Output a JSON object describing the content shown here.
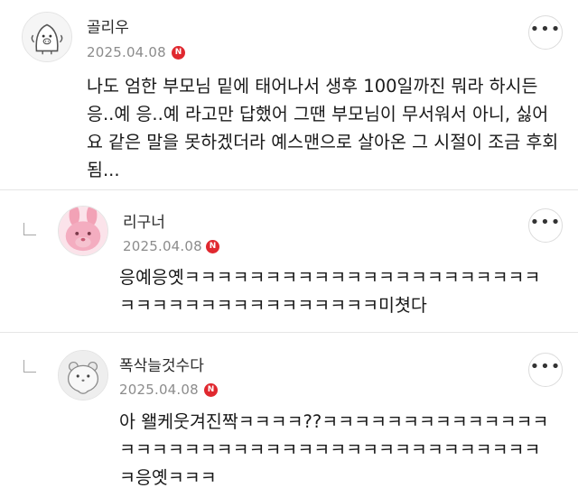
{
  "comments": [
    {
      "author": "골리우",
      "date": "2025.04.08",
      "badge": "N",
      "more": "•••",
      "text": "나도 엄한 부모님 밑에 태어나서 생후 100일까진 뭐라 하시든 응..예 응..예 라고만 답했어 그땐 부모님이 무서워서 아니, 싫어요 같은 말을 못하겠더라 예스맨으로 살아온 그 시절이 조금 후회됨...",
      "avatar_icon": "seal-character-icon"
    },
    {
      "author": "리구너",
      "date": "2025.04.08",
      "badge": "N",
      "more": "•••",
      "text": "응예응옛ㅋㅋㅋㅋㅋㅋㅋㅋㅋㅋㅋㅋㅋㅋㅋㅋㅋㅋㅋㅋㅋㅋㅋㅋㅋㅋㅋㅋㅋㅋㅋㅋㅋㅋㅋㅋㅋㅋ미쳣다",
      "avatar_icon": "pink-bunny-icon"
    },
    {
      "author": "폭삭늘것수다",
      "date": "2025.04.08",
      "badge": "N",
      "more": "•••",
      "text": "아 왤케웃겨진짝ㅋㅋㅋㅋ??ㅋㅋㅋㅋㅋㅋㅋㅋㅋㅋㅋㅋㅋㅋㅋㅋㅋㅋㅋㅋㅋㅋㅋㅋㅋㅋㅋㅋㅋㅋㅋㅋㅋㅋㅋㅋㅋㅋㅋㅋㅋ응옛ㅋㅋㅋ",
      "avatar_icon": "hamster-character-icon"
    }
  ],
  "colors": {
    "badge": "#e0282f",
    "date": "#8c8c8c",
    "divider": "#e6e6e6"
  }
}
